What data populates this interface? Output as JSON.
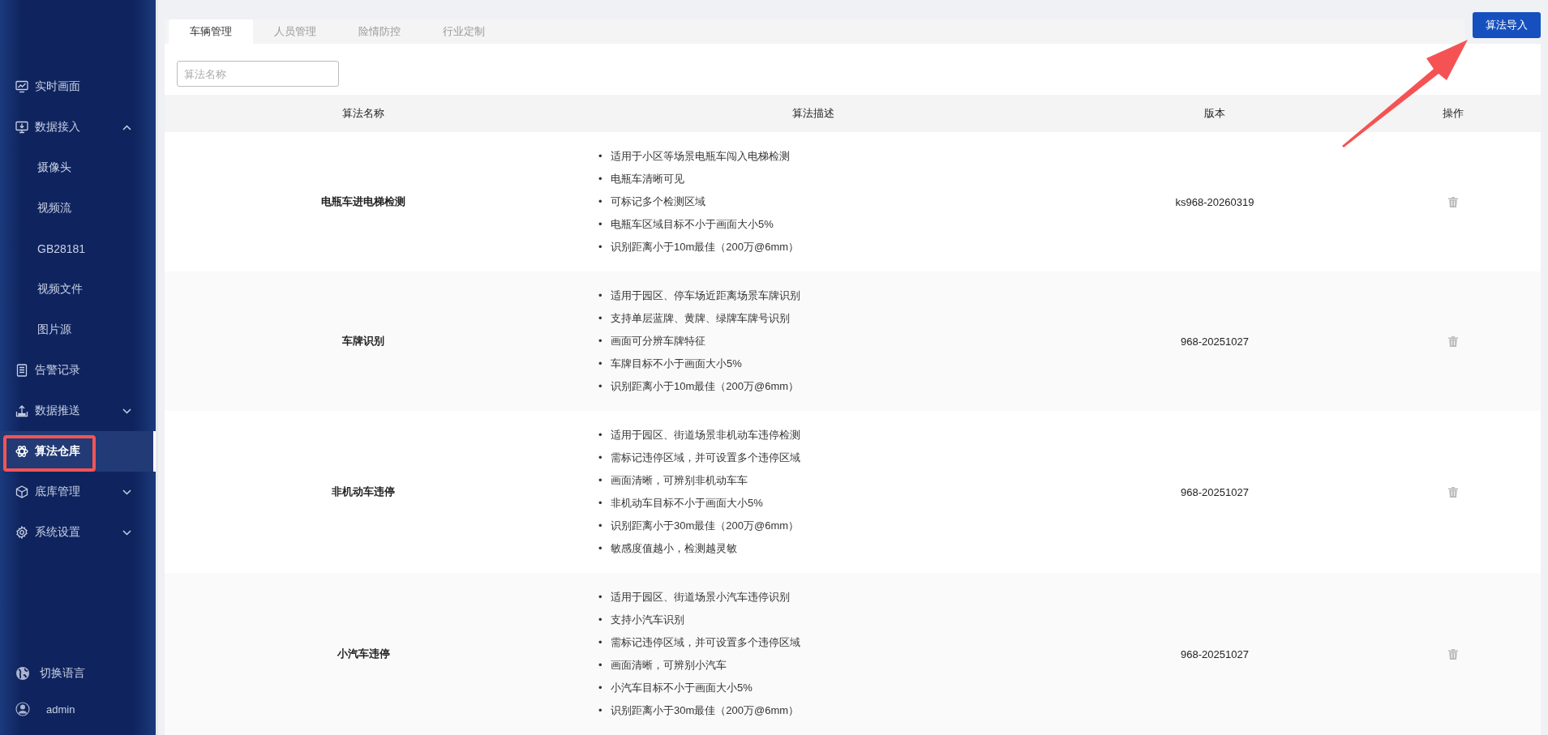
{
  "sidebar": {
    "items": [
      {
        "label": "实时画面",
        "kind": "link",
        "selected": false
      },
      {
        "label": "数据接入",
        "kind": "group",
        "selected": false,
        "expanded": true,
        "children": [
          {
            "label": "摄像头",
            "selected": false
          },
          {
            "label": "视频流",
            "selected": false
          },
          {
            "label": "GB28181",
            "selected": false
          },
          {
            "label": "视频文件",
            "selected": false
          },
          {
            "label": "图片源",
            "selected": false
          }
        ]
      },
      {
        "label": "告警记录",
        "kind": "link",
        "selected": false
      },
      {
        "label": "数据推送",
        "kind": "group",
        "selected": false,
        "expanded": false
      },
      {
        "label": "算法仓库",
        "kind": "link",
        "selected": true
      },
      {
        "label": "底库管理",
        "kind": "group",
        "selected": false,
        "expanded": false
      },
      {
        "label": "系统设置",
        "kind": "group",
        "selected": false,
        "expanded": false
      }
    ],
    "footer": {
      "language": "切换语言",
      "user": "admin"
    }
  },
  "tabs": [
    {
      "label": "车辆管理",
      "selected": true
    },
    {
      "label": "人员管理",
      "selected": false
    },
    {
      "label": "险情防控",
      "selected": false
    },
    {
      "label": "行业定制",
      "selected": false
    }
  ],
  "import_button": "算法导入",
  "search": {
    "placeholder": "算法名称"
  },
  "table": {
    "columns": [
      "算法名称",
      "算法描述",
      "版本",
      "操作"
    ],
    "bullet": "•",
    "rows": [
      {
        "name": "电瓶车进电梯检测",
        "description": [
          "适用于小区等场景电瓶车闯入电梯检测",
          "电瓶车清晰可见",
          "可标记多个检测区域",
          "电瓶车区域目标不小于画面大小5%",
          "识别距离小于10m最佳（200万@6mm）"
        ],
        "version": "ks968-20260319"
      },
      {
        "name": "车牌识别",
        "description": [
          "适用于园区、停车场近距离场景车牌识别",
          "支持单层蓝牌、黄牌、绿牌车牌号识别",
          "画面可分辨车牌特征",
          "车牌目标不小于画面大小5%",
          "识别距离小于10m最佳（200万@6mm）"
        ],
        "version": "968-20251027"
      },
      {
        "name": "非机动车违停",
        "description": [
          "适用于园区、街道场景非机动车违停检测",
          "需标记违停区域，并可设置多个违停区域",
          "画面清晰，可辨别非机动车车",
          "非机动车目标不小于画面大小5%",
          "识别距离小于30m最佳（200万@6mm）",
          "敏感度值越小，检测越灵敏"
        ],
        "version": "968-20251027"
      },
      {
        "name": "小汽车违停",
        "description": [
          "适用于园区、街道场景小汽车违停识别",
          "支持小汽车识别",
          "需标记违停区域，并可设置多个违停区域",
          "画面清晰，可辨别小汽车",
          "小汽车目标不小于画面大小5%",
          "识别距离小于30m最佳（200万@6mm）"
        ],
        "version": "968-20251027"
      }
    ]
  }
}
